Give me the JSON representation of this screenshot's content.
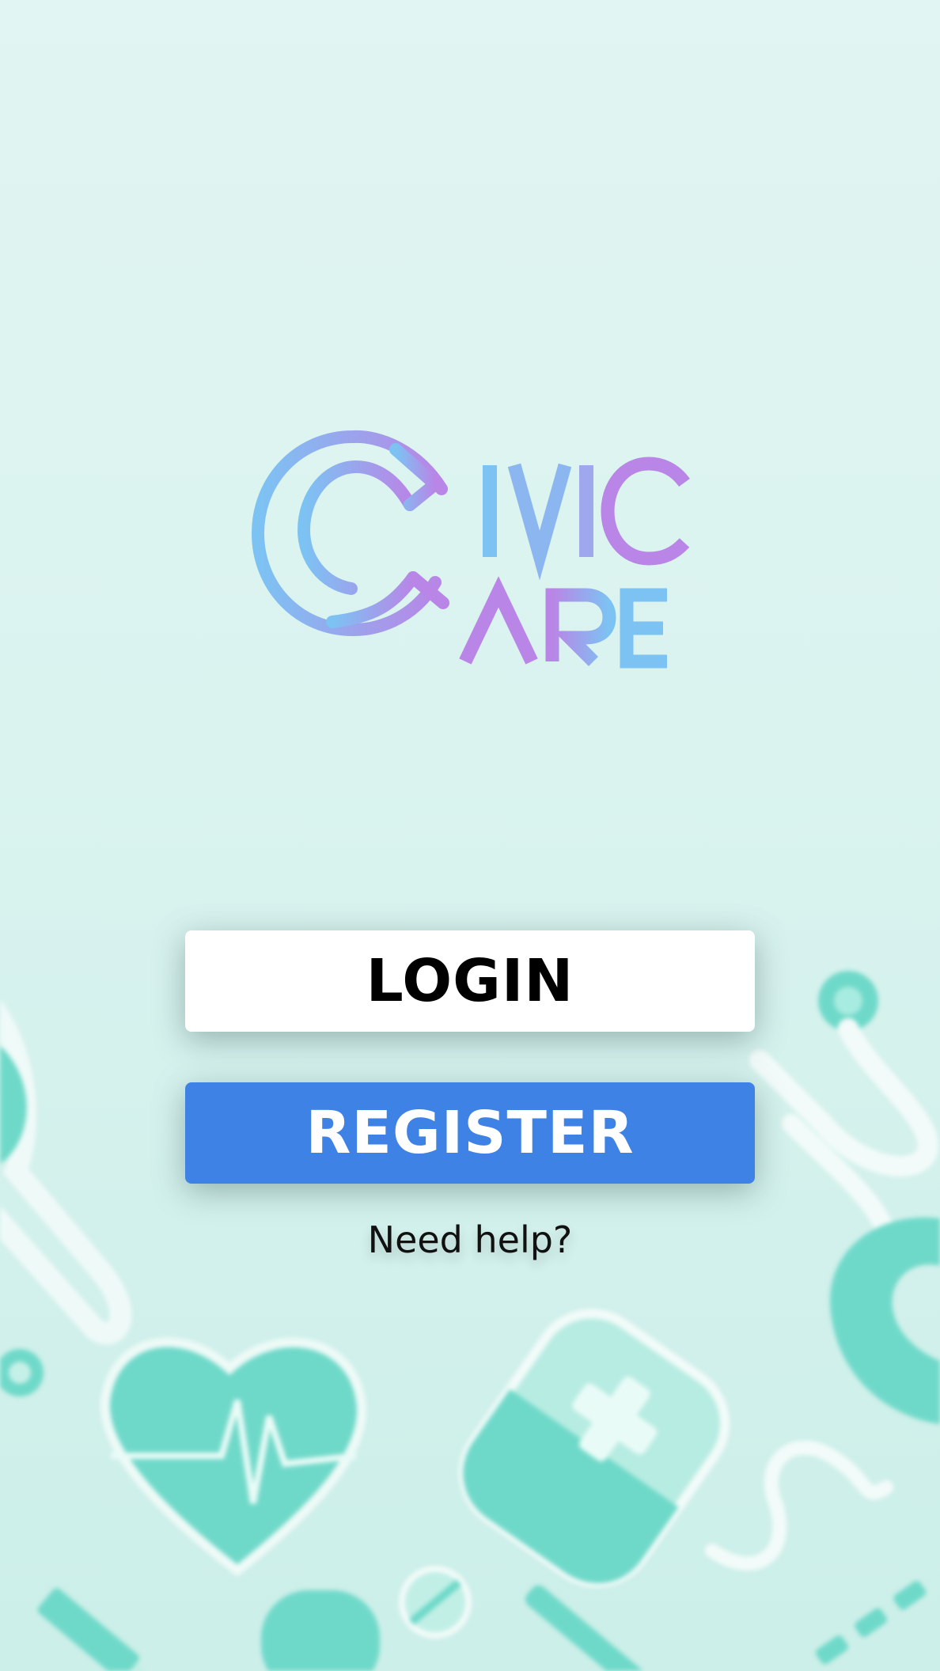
{
  "app": {
    "name": "CIVIC CARE"
  },
  "logo": {
    "icon": "civic-care-logo",
    "gradient_start": "#7cc3f3",
    "gradient_end": "#b985e6"
  },
  "actions": {
    "login_label": "LOGIN",
    "register_label": "REGISTER",
    "help_label": "Need help?"
  },
  "colors": {
    "background": "#dcf3ef",
    "accent_teal": "#6fd9c9",
    "register_blue": "#3f82e5",
    "login_bg": "#ffffff"
  },
  "decorations": [
    "stethoscope-icon",
    "heart-pulse-icon",
    "medicine-bag-icon",
    "pill-icon",
    "syringe-icon"
  ]
}
